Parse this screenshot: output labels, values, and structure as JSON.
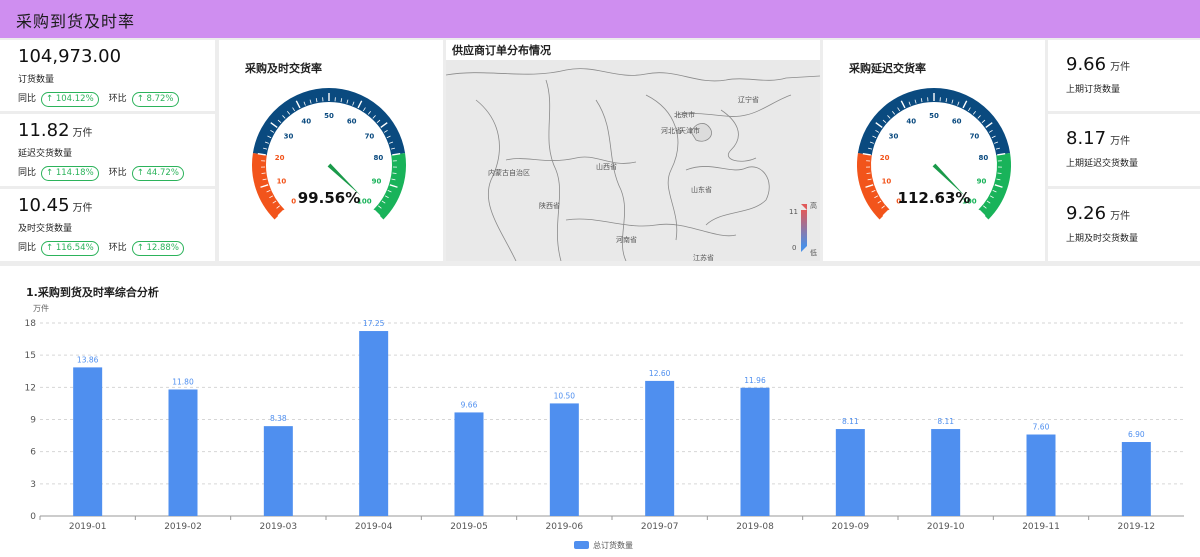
{
  "header": {
    "title": "采购到货及时率"
  },
  "kpis": [
    {
      "value": "104,973.00",
      "unit": "",
      "label": "订货数量",
      "yoy_label": "同比",
      "yoy": "↑ 104.12%",
      "mom_label": "环比",
      "mom": "↑ 8.72%"
    },
    {
      "value": "11.82",
      "unit": "万件",
      "label": "延迟交货数量",
      "yoy_label": "同比",
      "yoy": "↑ 114.18%",
      "mom_label": "环比",
      "mom": "↑ 44.72%"
    },
    {
      "value": "10.45",
      "unit": "万件",
      "label": "及时交货数量",
      "yoy_label": "同比",
      "yoy": "↑ 116.54%",
      "mom_label": "环比",
      "mom": "↑ 12.88%"
    }
  ],
  "gauges": [
    {
      "title": "采购及时交货率",
      "value": 99.56,
      "display": "99.56%",
      "ticks": [
        "0",
        "10",
        "20",
        "30",
        "40",
        "50",
        "60",
        "70",
        "80",
        "90",
        "100"
      ]
    },
    {
      "title": "采购延迟交货率",
      "value": 112.63,
      "display": "112.63%",
      "ticks": [
        "0",
        "10",
        "20",
        "30",
        "40",
        "50",
        "60",
        "70",
        "80",
        "90",
        "100"
      ]
    }
  ],
  "gauge_colors": {
    "low": "#f2541b",
    "mid": "#0a4a7f",
    "high": "#19b35a"
  },
  "map": {
    "title": "供应商订单分布情况",
    "labels": [
      "辽宁省",
      "北京市",
      "天津市",
      "河北省",
      "内蒙古自治区",
      "山西省",
      "山东省",
      "陕西省",
      "河南省",
      "江苏省"
    ],
    "legend_high": "高",
    "legend_low": "低",
    "legend_max": "11",
    "legend_min": "0"
  },
  "right_kpis": [
    {
      "value": "9.66",
      "unit": "万件",
      "label": "上期订货数量"
    },
    {
      "value": "8.17",
      "unit": "万件",
      "label": "上期延迟交货数量"
    },
    {
      "value": "9.26",
      "unit": "万件",
      "label": "上期及时交货数量"
    }
  ],
  "chart_data": {
    "type": "bar",
    "title": "1.采购到货及时率综合分析",
    "ylabel": "万件",
    "xlabel": "",
    "categories": [
      "2019-01",
      "2019-02",
      "2019-03",
      "2019-04",
      "2019-05",
      "2019-06",
      "2019-07",
      "2019-08",
      "2019-09",
      "2019-10",
      "2019-11",
      "2019-12"
    ],
    "series": [
      {
        "name": "总订货数量",
        "values": [
          13.86,
          11.8,
          8.38,
          17.25,
          9.66,
          10.5,
          12.6,
          11.96,
          8.11,
          8.11,
          7.6,
          6.9
        ],
        "value_labels": [
          "13.86",
          "11.80",
          "8.38",
          "17.25",
          "9.66",
          "10.50",
          "12.60",
          "11.96",
          "8.11",
          "8.11",
          "7.60",
          "6.90"
        ]
      }
    ],
    "ylim": [
      0,
      18
    ],
    "yticks": [
      "0",
      "3",
      "6",
      "9",
      "12",
      "15",
      "18"
    ],
    "grid": true,
    "legend_position": "bottom",
    "bar_color": "#4f8fef"
  }
}
